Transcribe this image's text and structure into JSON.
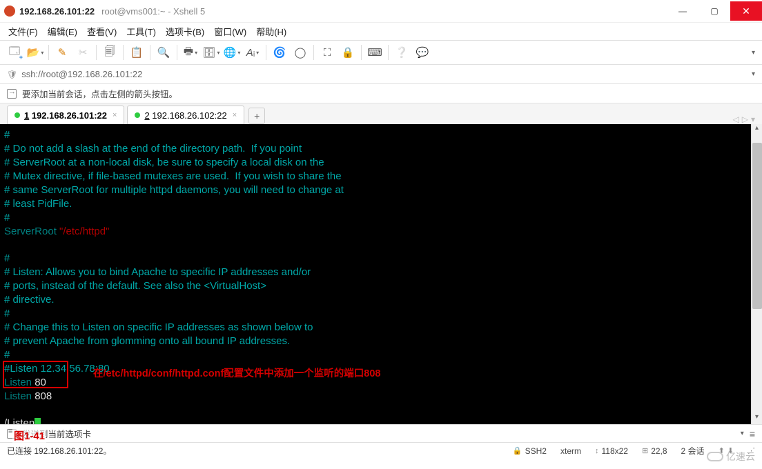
{
  "window": {
    "host": "192.168.26.101:22",
    "subtitle": "root@vms001:~ - Xshell 5"
  },
  "menu": {
    "file": "文件(F)",
    "edit": "编辑(E)",
    "view": "查看(V)",
    "tools": "工具(T)",
    "tabs": "选项卡(B)",
    "window": "窗口(W)",
    "help": "帮助(H)"
  },
  "address": "ssh://root@192.168.26.101:22",
  "hint": "要添加当前会话，点击左侧的箭头按钮。",
  "tabs": [
    {
      "label": "1 192.168.26.101:22",
      "active": true
    },
    {
      "label": "2 192.168.26.102:22",
      "active": false
    }
  ],
  "terminal": {
    "lines": [
      {
        "c": "c-cyan",
        "t": "#"
      },
      {
        "c": "c-cyan",
        "t": "# Do not add a slash at the end of the directory path.  If you point"
      },
      {
        "c": "c-cyan",
        "t": "# ServerRoot at a non-local disk, be sure to specify a local disk on the"
      },
      {
        "c": "c-cyan",
        "t": "# Mutex directive, if file-based mutexes are used.  If you wish to share the"
      },
      {
        "c": "c-cyan",
        "t": "# same ServerRoot for multiple httpd daemons, you will need to change at"
      },
      {
        "c": "c-cyan",
        "t": "# least PidFile."
      },
      {
        "c": "c-cyan",
        "t": "#"
      }
    ],
    "serverroot_key": "ServerRoot",
    "serverroot_val": " \"/etc/httpd\"",
    "listen_block": [
      "#",
      "# Listen: Allows you to bind Apache to specific IP addresses and/or",
      "# ports, instead of the default. See also the <VirtualHost>",
      "# directive.",
      "#",
      "# Change this to Listen on specific IP addresses as shown below to",
      "# prevent Apache from glomming onto all bound IP addresses.",
      "#",
      "#Listen 12.34.56.78:80"
    ],
    "listen1_k": "Listen",
    "listen1_v": " 80",
    "listen2_k": "Listen",
    "listen2_v": " 808",
    "search": "/Listen",
    "annotation": "在/etc/httpd/conf/httpd.conf配置文件中添加一个监听的端口808",
    "figure": "图1-41"
  },
  "cmdhint": "发送到当前选项卡",
  "status": {
    "conn": "已连接 192.168.26.101:22。",
    "proto": "SSH2",
    "term": "xterm",
    "size": "118x22",
    "pos": "22,8",
    "sessions": "2 会话"
  },
  "watermark": "亿速云"
}
